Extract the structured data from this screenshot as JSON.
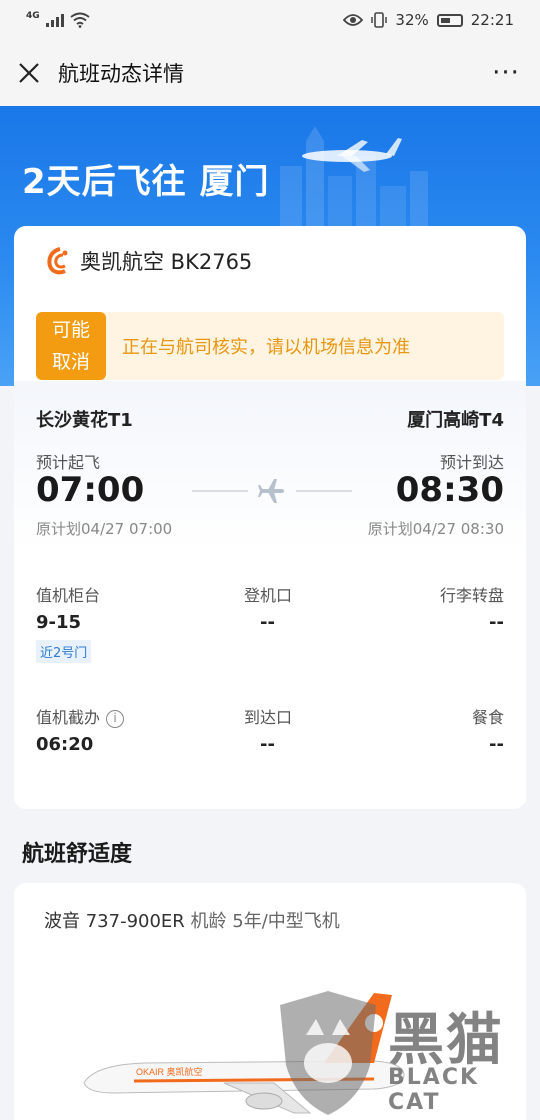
{
  "status_bar": {
    "network": "4G",
    "battery": "32%",
    "time": "22:21"
  },
  "nav": {
    "title": "航班动态详情",
    "more": "···"
  },
  "hero": {
    "title": "2天后飞往 厦门"
  },
  "flight": {
    "airline_flight": "奥凯航空 BK2765",
    "warning_badge_line1": "可能",
    "warning_badge_line2": "取消",
    "warning_text": "正在与航司核实，请以机场信息为准",
    "departure_airport": "长沙黄花T1",
    "arrival_airport": "厦门高崎T4",
    "dep_label": "预计起飞",
    "arr_label": "预计到达",
    "dep_time": "07:00",
    "arr_time": "08:30",
    "dep_orig": "原计划04/27 07:00",
    "arr_orig": "原计划04/27 08:30"
  },
  "details": {
    "checkin_counter_label": "值机柜台",
    "checkin_counter_value": "9-15",
    "checkin_counter_tag": "近2号门",
    "gate_label": "登机口",
    "gate_value": "--",
    "baggage_label": "行李转盘",
    "baggage_value": "--",
    "checkin_deadline_label": "值机截办",
    "checkin_deadline_value": "06:20",
    "arrival_gate_label": "到达口",
    "arrival_gate_value": "--",
    "meal_label": "餐食",
    "meal_value": "--"
  },
  "comfort": {
    "title": "航班舒适度",
    "aircraft": "波音 737-900ER",
    "aircraft_sub": "机龄 5年/中型飞机",
    "livery": "OKAIR 奥凯航空"
  },
  "watermark": {
    "cn": "黑猫",
    "en": "BLACK CAT"
  },
  "colors": {
    "primary_blue": "#1a77e8",
    "warning_orange": "#f39c12",
    "warning_bg": "#fff4e2",
    "tag_blue": "#2e7bd6"
  }
}
